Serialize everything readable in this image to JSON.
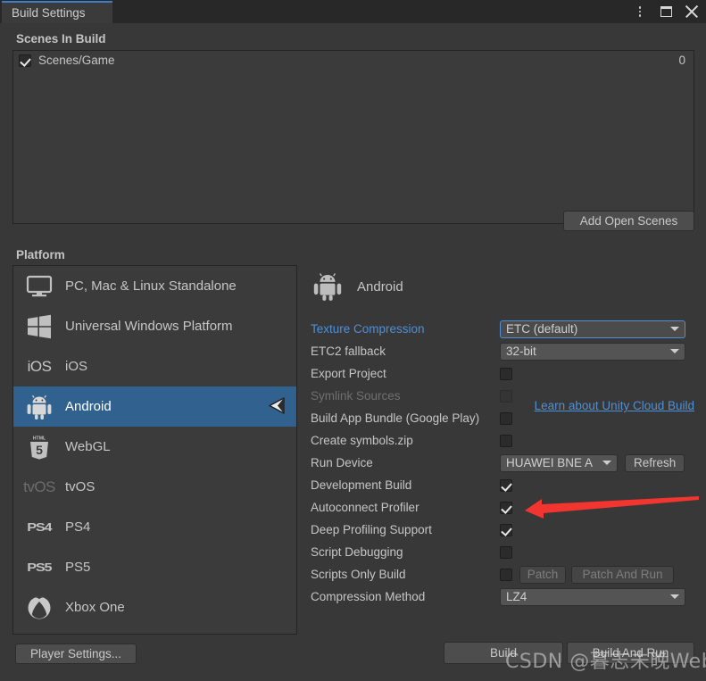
{
  "window": {
    "tab_label": "Build Settings",
    "controls": [
      {
        "name": "more-options",
        "glyph": "kebab"
      },
      {
        "name": "maximize",
        "glyph": "square"
      },
      {
        "name": "close",
        "glyph": "x"
      }
    ]
  },
  "scenes": {
    "title": "Scenes In Build",
    "items": [
      {
        "name": "Scenes/Game",
        "checked": true,
        "index": "0"
      }
    ],
    "add_open_scenes_label": "Add Open Scenes"
  },
  "platform": {
    "title": "Platform",
    "items": [
      {
        "label": "PC, Mac & Linux Standalone",
        "icon": "monitor-icon",
        "selected": false,
        "disabled": false
      },
      {
        "label": "Universal Windows Platform",
        "icon": "windows-icon",
        "selected": false,
        "disabled": false
      },
      {
        "label": "iOS",
        "icon": "ios-icon",
        "selected": false,
        "disabled": false
      },
      {
        "label": "Android",
        "icon": "android-icon",
        "selected": true,
        "disabled": false
      },
      {
        "label": "WebGL",
        "icon": "html5-icon",
        "selected": false,
        "disabled": false
      },
      {
        "label": "tvOS",
        "icon": "tvos-icon",
        "selected": false,
        "disabled": true
      },
      {
        "label": "PS4",
        "icon": "ps4-icon",
        "selected": false,
        "disabled": false
      },
      {
        "label": "PS5",
        "icon": "ps5-icon",
        "selected": false,
        "disabled": false
      },
      {
        "label": "Xbox One",
        "icon": "xbox-icon",
        "selected": false,
        "disabled": false
      }
    ]
  },
  "settings": {
    "header_title": "Android",
    "header_icon": "android-icon",
    "texture_compression": {
      "label": "Texture Compression",
      "value": "ETC (default)"
    },
    "etc2_fallback": {
      "label": "ETC2 fallback",
      "value": "32-bit"
    },
    "export_project": {
      "label": "Export Project",
      "checked": false
    },
    "symlink_sources": {
      "label": "Symlink Sources",
      "checked": false
    },
    "build_app_bundle": {
      "label": "Build App Bundle (Google Play)",
      "checked": false
    },
    "create_symbols_zip": {
      "label": "Create symbols.zip",
      "checked": false
    },
    "run_device": {
      "label": "Run Device",
      "value": "HUAWEI BNE A",
      "refresh_label": "Refresh"
    },
    "development_build": {
      "label": "Development Build",
      "checked": true
    },
    "autoconnect_profiler": {
      "label": "Autoconnect Profiler",
      "checked": true
    },
    "deep_profiling": {
      "label": "Deep Profiling Support",
      "checked": true
    },
    "script_debugging": {
      "label": "Script Debugging",
      "checked": false
    },
    "scripts_only_build": {
      "label": "Scripts Only Build",
      "checked": false,
      "patch_label": "Patch",
      "patch_and_run_label": "Patch And Run"
    },
    "compression_method": {
      "label": "Compression Method",
      "value": "LZ4"
    },
    "cloud_build_link": "Learn about Unity Cloud Build"
  },
  "footer": {
    "player_settings_label": "Player Settings...",
    "build_label": "Build",
    "build_and_run_label": "Build And Run"
  },
  "watermark": "CSDN @暮志未晚Webgl",
  "colors": {
    "accent_blue": "#4e8fd6",
    "selection_blue": "#31628f",
    "panel_bg": "#383838",
    "list_bg": "#3b3b3b",
    "annotation_red": "#f2352e"
  }
}
